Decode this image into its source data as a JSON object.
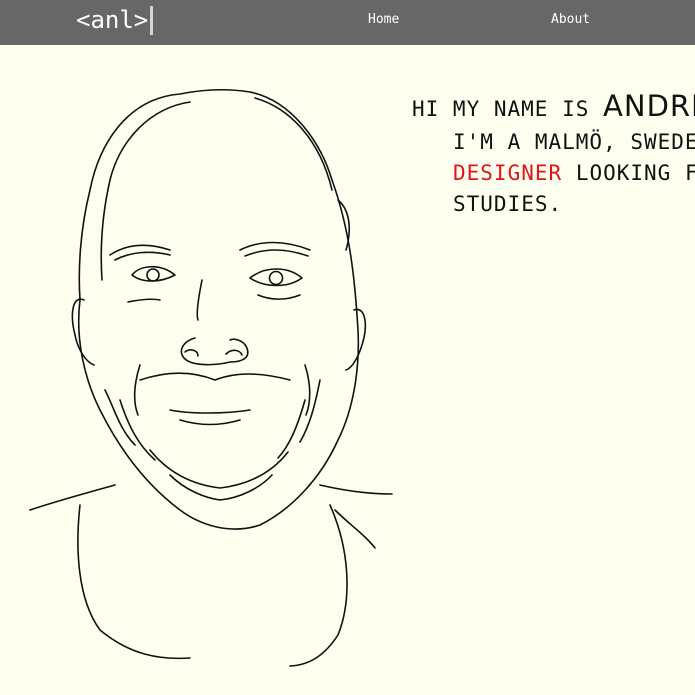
{
  "nav": {
    "logo": "<anl>",
    "links": [
      {
        "label": "Home"
      },
      {
        "label": "About"
      }
    ]
  },
  "intro": {
    "greeting": "Hi my name is",
    "name": "André!",
    "line2": "I'm a Malmö, Sweden",
    "role": "designer",
    "line3_rest": "looking for",
    "line4": "studies."
  },
  "colors": {
    "navbar": "#676767",
    "background": "#fffff0",
    "accent": "#e0141b",
    "text": "#111111"
  }
}
